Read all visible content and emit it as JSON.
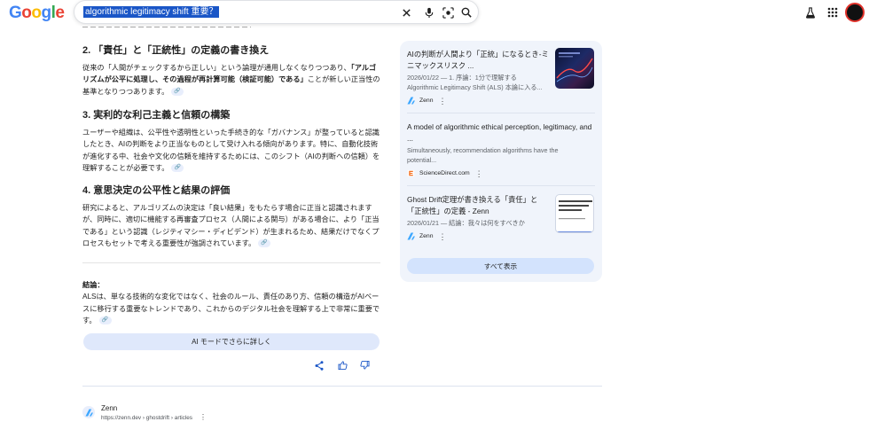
{
  "header": {
    "logo": [
      "G",
      "o",
      "o",
      "g",
      "l",
      "e"
    ],
    "logo_colors": [
      "#4285f4",
      "#ea4335",
      "#fbbc05",
      "#4285f4",
      "#34a853",
      "#ea4335"
    ],
    "query": "algorithmic legitimacy shift 重要？"
  },
  "answer": {
    "sections": [
      {
        "heading": "2. 「責任」と「正統性」の定義の書き換え",
        "text_before": "従来の「人間がチェックするから正しい」という論理が通用しなくなりつつあり、",
        "text_bold": "「アルゴリズムが公平に処理し、その過程が再計算可能（検証可能）である」",
        "text_after": "ことが新しい正当性の基準となりつつあります。"
      },
      {
        "heading": "3. 実利的な利己主義と信頼の構築",
        "text": "ユーザーや組織は、公平性や透明性といった手続き的な「ガバナンス」が整っていると認識したとき、AIの判断をより正当なものとして受け入れる傾向があります。特に、自動化技術が進化する中、社会や文化の信頼を維持するためには、このシフト（AIの判断への信頼）を理解することが必要です。"
      },
      {
        "heading": "4. 意思決定の公平性と結果の評価",
        "text": "研究によると、アルゴリズムの決定は「良い結果」をもたらす場合に正当と認識されますが、同時に、適切に機能する再審査プロセス（人間による関与）がある場合に、より「正当である」という認識（レジティマシー・ディビデンド）が生まれるため、結果だけでなくプロセスもセットで考える重要性が強調されています。"
      }
    ],
    "conclusion_label": "結論：",
    "conclusion_text": "ALSは、単なる技術的な変化ではなく、社会のルール、責任のあり方、信頼の構造がAIベースに移行する重要なトレンドであり、これからのデジタル社会を理解する上で非常に重要です。",
    "ai_mode_button": "AI モードでさらに詳しく"
  },
  "sources": {
    "cards": [
      {
        "title": "AIの判断が人間より「正統」になるとき-ミニマックスリスク ...",
        "snippet": "2026/01/22 — 1. 序論：1分で理解する Algorithmic Legitimacy Shift (ALS) 本論に入る...",
        "source": "Zenn"
      },
      {
        "title": "A model of algorithmic ethical perception, legitimacy, and ...",
        "snippet": "Simultaneously, recommendation algorithms have the potential...",
        "source": "ScienceDirect.com"
      },
      {
        "title": "Ghost Drift定理が書き換える「責任」と「正統性」の定義 - Zenn",
        "snippet": "2026/01/21 — 結論：我々は何をすべきか",
        "source": "Zenn"
      }
    ],
    "show_all": "すべて表示"
  },
  "result": {
    "site_name": "Zenn",
    "url": "https://zenn.dev › ghostdrift › articles"
  }
}
